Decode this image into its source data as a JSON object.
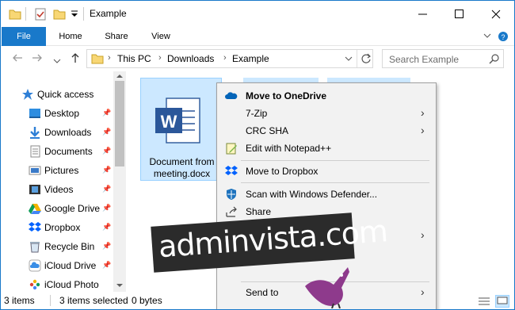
{
  "window": {
    "title": "Example"
  },
  "controls": {
    "minimize": "—",
    "maximize": "☐",
    "close": "✕"
  },
  "ribbon": {
    "tabs": [
      {
        "label": "File"
      },
      {
        "label": "Home"
      },
      {
        "label": "Share"
      },
      {
        "label": "View"
      }
    ]
  },
  "address": {
    "breadcrumbs": [
      "This PC",
      "Downloads",
      "Example"
    ],
    "search_placeholder": "Search Example"
  },
  "navpane": {
    "items": [
      {
        "label": "Quick access",
        "icon": "star-icon",
        "pinned": false
      },
      {
        "label": "Desktop",
        "icon": "desktop-folder-icon",
        "pinned": true
      },
      {
        "label": "Downloads",
        "icon": "download-arrow-icon",
        "pinned": true
      },
      {
        "label": "Documents",
        "icon": "documents-icon",
        "pinned": true
      },
      {
        "label": "Pictures",
        "icon": "pictures-icon",
        "pinned": true
      },
      {
        "label": "Videos",
        "icon": "videos-icon",
        "pinned": true
      },
      {
        "label": "Google Drive",
        "icon": "google-drive-icon",
        "pinned": true
      },
      {
        "label": "Dropbox",
        "icon": "dropbox-icon",
        "pinned": true
      },
      {
        "label": "Recycle Bin",
        "icon": "recycle-bin-icon",
        "pinned": true
      },
      {
        "label": "iCloud Drive",
        "icon": "icloud-icon",
        "pinned": true
      },
      {
        "label": "iCloud Photo",
        "icon": "icloud-photos-icon",
        "pinned": false
      }
    ]
  },
  "content": {
    "file": {
      "name_line1": "Document from",
      "name_line2": "meeting.docx",
      "icon": "word-document-icon"
    }
  },
  "context_menu": {
    "items": [
      {
        "label": "Move to OneDrive",
        "icon": "onedrive-icon",
        "bold": true,
        "submenu": false
      },
      {
        "label": "7-Zip",
        "icon": "",
        "bold": false,
        "submenu": true
      },
      {
        "label": "CRC SHA",
        "icon": "",
        "bold": false,
        "submenu": true
      },
      {
        "label": "Edit with Notepad++",
        "icon": "notepad-plus-plus-icon",
        "bold": false,
        "submenu": false
      },
      {
        "label": "Move to Dropbox",
        "icon": "dropbox-icon",
        "bold": false,
        "submenu": false
      },
      {
        "label": "Scan with Windows Defender...",
        "icon": "windows-defender-icon",
        "bold": false,
        "submenu": false
      },
      {
        "label": "Share",
        "icon": "share-icon",
        "bold": false,
        "submenu": false
      },
      {
        "label": "Send to",
        "icon": "",
        "bold": false,
        "submenu": true
      }
    ]
  },
  "status": {
    "items_count": "3 items",
    "selected": "3 items selected",
    "size": "0 bytes"
  },
  "watermark": {
    "text": "adminvista.com"
  },
  "colors": {
    "accent": "#1979ca",
    "selection": "#cce8ff",
    "selection_border": "#99d1ff",
    "word_blue": "#2b579a"
  }
}
